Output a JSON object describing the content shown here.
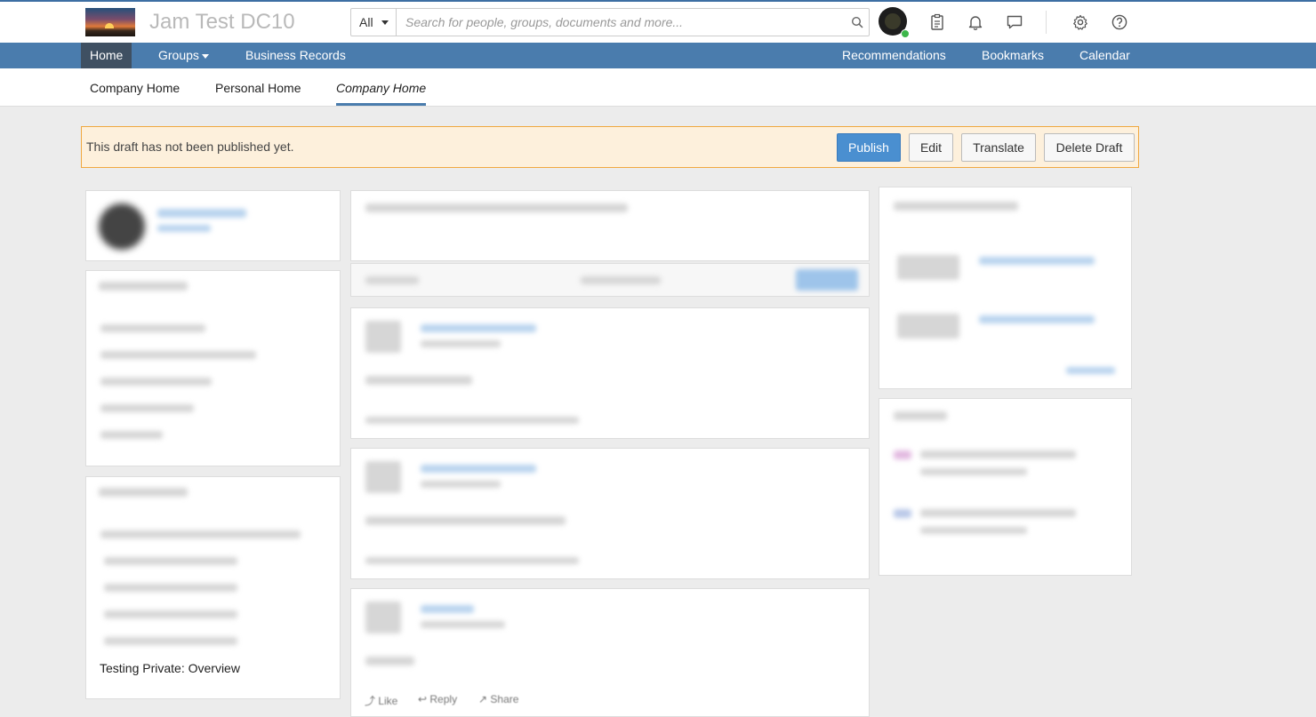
{
  "header": {
    "site_title": "Jam Test DC10",
    "search": {
      "scope": "All",
      "placeholder": "Search for people, groups, documents and more..."
    },
    "icons": [
      "search-icon",
      "tasks-icon",
      "bell-icon",
      "chat-icon",
      "gear-icon",
      "help-icon"
    ]
  },
  "nav": {
    "home": "Home",
    "groups": "Groups",
    "business_records": "Business Records",
    "recommendations": "Recommendations",
    "bookmarks": "Bookmarks",
    "calendar": "Calendar"
  },
  "subnav": {
    "company_home": "Company Home",
    "personal_home": "Personal Home",
    "company_home_current": "Company Home"
  },
  "draft": {
    "message": "This draft has not been published yet.",
    "publish": "Publish",
    "edit": "Edit",
    "translate": "Translate",
    "delete": "Delete Draft"
  },
  "left": {
    "overview_title": "Testing Private: Overview"
  },
  "feed": {
    "like": "Like",
    "reply": "Reply",
    "share": "Share"
  },
  "colors": {
    "nav": "#4a7cad",
    "nav_active": "#3f5062",
    "draft_bg": "#fdf0dc",
    "draft_border": "#f0a840",
    "primary": "#4a8fd0"
  }
}
